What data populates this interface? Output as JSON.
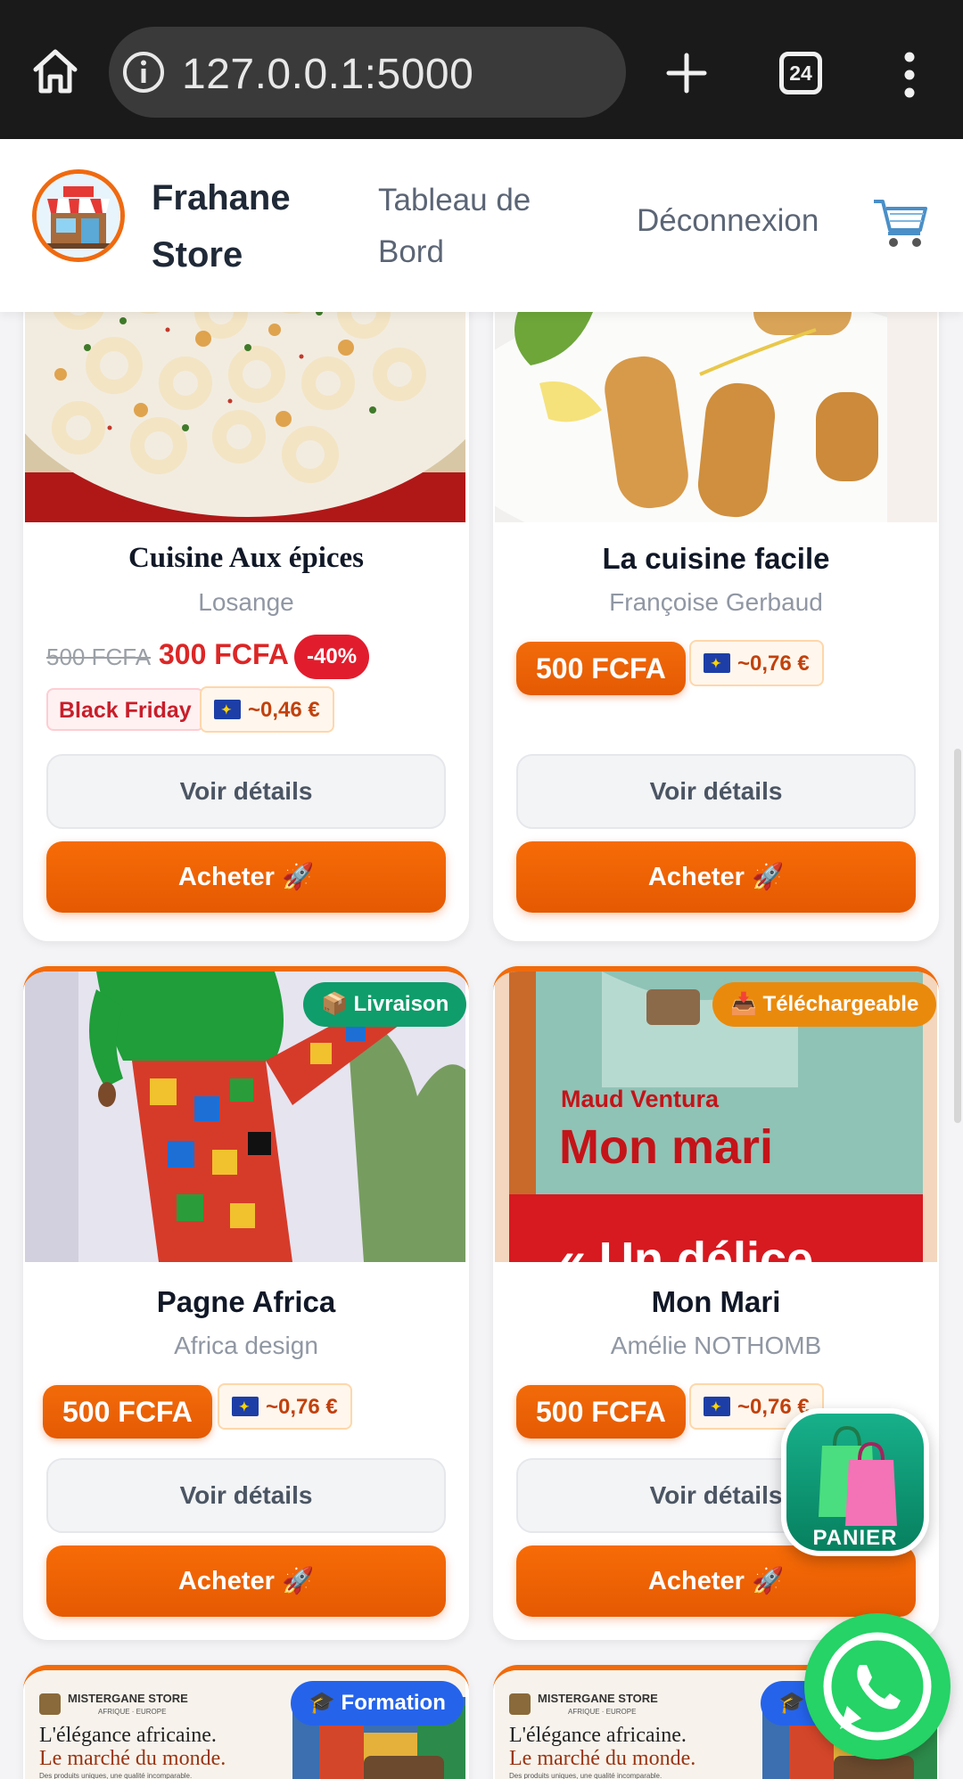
{
  "browser": {
    "url": "127.0.0.1:5000",
    "tab_count": "24"
  },
  "header": {
    "brand_name": "Frahane Store",
    "nav": {
      "dashboard": "Tableau de Bord",
      "logout": "Déconnexion"
    }
  },
  "products": [
    {
      "title": "Cuisine Aux épices",
      "author": "Losange",
      "old_price": "500 FCFA",
      "price": "300 FCFA",
      "discount": "-40%",
      "promo_tag": "Black Friday",
      "euro_price": "~0,46 €",
      "details_label": "Voir détails",
      "buy_label": "Acheter 🚀"
    },
    {
      "title": "La cuisine facile",
      "author": "Françoise Gerbaud",
      "price": "500 FCFA",
      "euro_price": "~0,76 €",
      "details_label": "Voir détails",
      "buy_label": "Acheter 🚀"
    },
    {
      "title": "Pagne Africa",
      "author": "Africa design",
      "badge": "📦 Livraison",
      "price": "500 FCFA",
      "euro_price": "~0,76 €",
      "details_label": "Voir détails",
      "buy_label": "Acheter 🚀"
    },
    {
      "title": "Mon Mari",
      "author": "Amélie NOTHOMB",
      "badge": "📥 Téléchargeable",
      "cover_author": "Maud Ventura",
      "cover_title": "Mon mari",
      "cover_quote": "« Un délice",
      "price": "500 FCFA",
      "euro_price": "~0,76 €",
      "details_label": "Voir détails",
      "buy_label": "Acheter 🚀"
    },
    {
      "badge": "🎓 Formation",
      "banner_brand": "MISTERGANE STORE",
      "banner_sub": "AFRIQUE · EUROPE",
      "banner_line1": "L'élégance africaine.",
      "banner_line2": "Le marché du monde.",
      "banner_small": "Des produits uniques, une qualité incomparable."
    },
    {
      "badge": "🎓 Formation",
      "banner_brand": "MISTERGANE STORE",
      "banner_sub": "AFRIQUE · EUROPE",
      "banner_line1": "L'élégance africaine.",
      "banner_line2": "Le marché du monde.",
      "banner_small": "Des produits uniques, une qualité incomparable."
    }
  ],
  "floating": {
    "cart_label": "PANIER"
  }
}
